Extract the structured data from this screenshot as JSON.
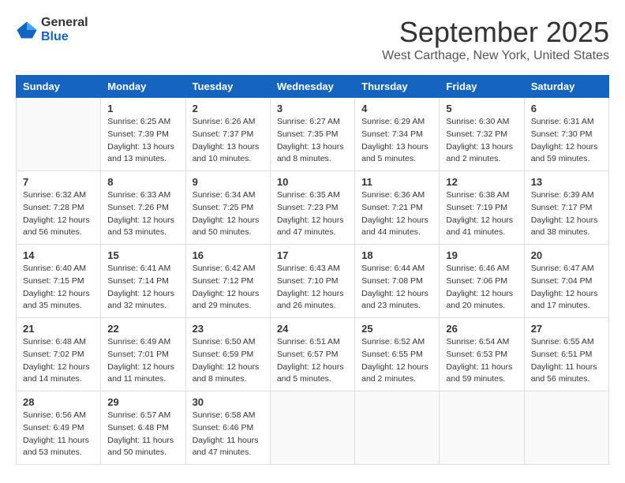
{
  "logo": {
    "line1": "General",
    "line2": "Blue"
  },
  "title": "September 2025",
  "subtitle": "West Carthage, New York, United States",
  "days_of_week": [
    "Sunday",
    "Monday",
    "Tuesday",
    "Wednesday",
    "Thursday",
    "Friday",
    "Saturday"
  ],
  "weeks": [
    [
      {
        "day": "",
        "sunrise": "",
        "sunset": "",
        "daylight": ""
      },
      {
        "day": "1",
        "sunrise": "Sunrise: 6:25 AM",
        "sunset": "Sunset: 7:39 PM",
        "daylight": "Daylight: 13 hours and 13 minutes."
      },
      {
        "day": "2",
        "sunrise": "Sunrise: 6:26 AM",
        "sunset": "Sunset: 7:37 PM",
        "daylight": "Daylight: 13 hours and 10 minutes."
      },
      {
        "day": "3",
        "sunrise": "Sunrise: 6:27 AM",
        "sunset": "Sunset: 7:35 PM",
        "daylight": "Daylight: 13 hours and 8 minutes."
      },
      {
        "day": "4",
        "sunrise": "Sunrise: 6:29 AM",
        "sunset": "Sunset: 7:34 PM",
        "daylight": "Daylight: 13 hours and 5 minutes."
      },
      {
        "day": "5",
        "sunrise": "Sunrise: 6:30 AM",
        "sunset": "Sunset: 7:32 PM",
        "daylight": "Daylight: 13 hours and 2 minutes."
      },
      {
        "day": "6",
        "sunrise": "Sunrise: 6:31 AM",
        "sunset": "Sunset: 7:30 PM",
        "daylight": "Daylight: 12 hours and 59 minutes."
      }
    ],
    [
      {
        "day": "7",
        "sunrise": "Sunrise: 6:32 AM",
        "sunset": "Sunset: 7:28 PM",
        "daylight": "Daylight: 12 hours and 56 minutes."
      },
      {
        "day": "8",
        "sunrise": "Sunrise: 6:33 AM",
        "sunset": "Sunset: 7:26 PM",
        "daylight": "Daylight: 12 hours and 53 minutes."
      },
      {
        "day": "9",
        "sunrise": "Sunrise: 6:34 AM",
        "sunset": "Sunset: 7:25 PM",
        "daylight": "Daylight: 12 hours and 50 minutes."
      },
      {
        "day": "10",
        "sunrise": "Sunrise: 6:35 AM",
        "sunset": "Sunset: 7:23 PM",
        "daylight": "Daylight: 12 hours and 47 minutes."
      },
      {
        "day": "11",
        "sunrise": "Sunrise: 6:36 AM",
        "sunset": "Sunset: 7:21 PM",
        "daylight": "Daylight: 12 hours and 44 minutes."
      },
      {
        "day": "12",
        "sunrise": "Sunrise: 6:38 AM",
        "sunset": "Sunset: 7:19 PM",
        "daylight": "Daylight: 12 hours and 41 minutes."
      },
      {
        "day": "13",
        "sunrise": "Sunrise: 6:39 AM",
        "sunset": "Sunset: 7:17 PM",
        "daylight": "Daylight: 12 hours and 38 minutes."
      }
    ],
    [
      {
        "day": "14",
        "sunrise": "Sunrise: 6:40 AM",
        "sunset": "Sunset: 7:15 PM",
        "daylight": "Daylight: 12 hours and 35 minutes."
      },
      {
        "day": "15",
        "sunrise": "Sunrise: 6:41 AM",
        "sunset": "Sunset: 7:14 PM",
        "daylight": "Daylight: 12 hours and 32 minutes."
      },
      {
        "day": "16",
        "sunrise": "Sunrise: 6:42 AM",
        "sunset": "Sunset: 7:12 PM",
        "daylight": "Daylight: 12 hours and 29 minutes."
      },
      {
        "day": "17",
        "sunrise": "Sunrise: 6:43 AM",
        "sunset": "Sunset: 7:10 PM",
        "daylight": "Daylight: 12 hours and 26 minutes."
      },
      {
        "day": "18",
        "sunrise": "Sunrise: 6:44 AM",
        "sunset": "Sunset: 7:08 PM",
        "daylight": "Daylight: 12 hours and 23 minutes."
      },
      {
        "day": "19",
        "sunrise": "Sunrise: 6:46 AM",
        "sunset": "Sunset: 7:06 PM",
        "daylight": "Daylight: 12 hours and 20 minutes."
      },
      {
        "day": "20",
        "sunrise": "Sunrise: 6:47 AM",
        "sunset": "Sunset: 7:04 PM",
        "daylight": "Daylight: 12 hours and 17 minutes."
      }
    ],
    [
      {
        "day": "21",
        "sunrise": "Sunrise: 6:48 AM",
        "sunset": "Sunset: 7:02 PM",
        "daylight": "Daylight: 12 hours and 14 minutes."
      },
      {
        "day": "22",
        "sunrise": "Sunrise: 6:49 AM",
        "sunset": "Sunset: 7:01 PM",
        "daylight": "Daylight: 12 hours and 11 minutes."
      },
      {
        "day": "23",
        "sunrise": "Sunrise: 6:50 AM",
        "sunset": "Sunset: 6:59 PM",
        "daylight": "Daylight: 12 hours and 8 minutes."
      },
      {
        "day": "24",
        "sunrise": "Sunrise: 6:51 AM",
        "sunset": "Sunset: 6:57 PM",
        "daylight": "Daylight: 12 hours and 5 minutes."
      },
      {
        "day": "25",
        "sunrise": "Sunrise: 6:52 AM",
        "sunset": "Sunset: 6:55 PM",
        "daylight": "Daylight: 12 hours and 2 minutes."
      },
      {
        "day": "26",
        "sunrise": "Sunrise: 6:54 AM",
        "sunset": "Sunset: 6:53 PM",
        "daylight": "Daylight: 11 hours and 59 minutes."
      },
      {
        "day": "27",
        "sunrise": "Sunrise: 6:55 AM",
        "sunset": "Sunset: 6:51 PM",
        "daylight": "Daylight: 11 hours and 56 minutes."
      }
    ],
    [
      {
        "day": "28",
        "sunrise": "Sunrise: 6:56 AM",
        "sunset": "Sunset: 6:49 PM",
        "daylight": "Daylight: 11 hours and 53 minutes."
      },
      {
        "day": "29",
        "sunrise": "Sunrise: 6:57 AM",
        "sunset": "Sunset: 6:48 PM",
        "daylight": "Daylight: 11 hours and 50 minutes."
      },
      {
        "day": "30",
        "sunrise": "Sunrise: 6:58 AM",
        "sunset": "Sunset: 6:46 PM",
        "daylight": "Daylight: 11 hours and 47 minutes."
      },
      {
        "day": "",
        "sunrise": "",
        "sunset": "",
        "daylight": ""
      },
      {
        "day": "",
        "sunrise": "",
        "sunset": "",
        "daylight": ""
      },
      {
        "day": "",
        "sunrise": "",
        "sunset": "",
        "daylight": ""
      },
      {
        "day": "",
        "sunrise": "",
        "sunset": "",
        "daylight": ""
      }
    ]
  ]
}
